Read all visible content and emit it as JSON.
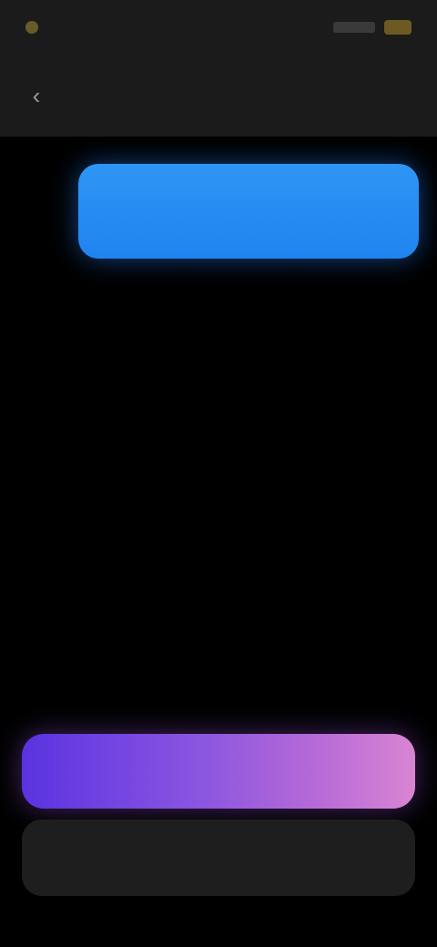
{
  "status_bar": {
    "time": "",
    "battery_color": "#6d5a22"
  },
  "header": {
    "back_icon": "chevron-left-icon",
    "title": "",
    "action_label": ""
  },
  "conversation": {
    "outgoing_message": "",
    "bubble_color": "#1f84ef"
  },
  "actions": {
    "primary_label": "",
    "primary_gradient": [
      "#5a33e0",
      "#d885d2"
    ],
    "secondary_label": ""
  }
}
